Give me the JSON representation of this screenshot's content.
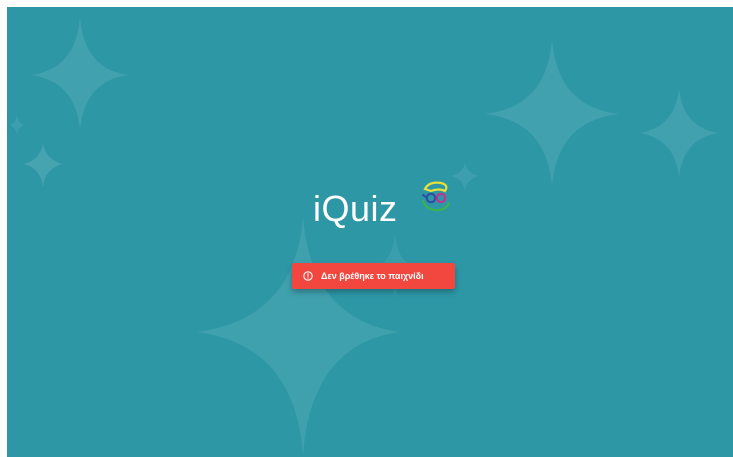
{
  "app": {
    "logo_text": "iQuiz"
  },
  "alert": {
    "message": "Δεν βρέθηκε το παιχνίδι",
    "icon": "exclamation-circle-icon"
  },
  "theme": {
    "background": "#2d97a6",
    "alert_background": "#f1473e",
    "logo_text_color": "#ffffff"
  }
}
